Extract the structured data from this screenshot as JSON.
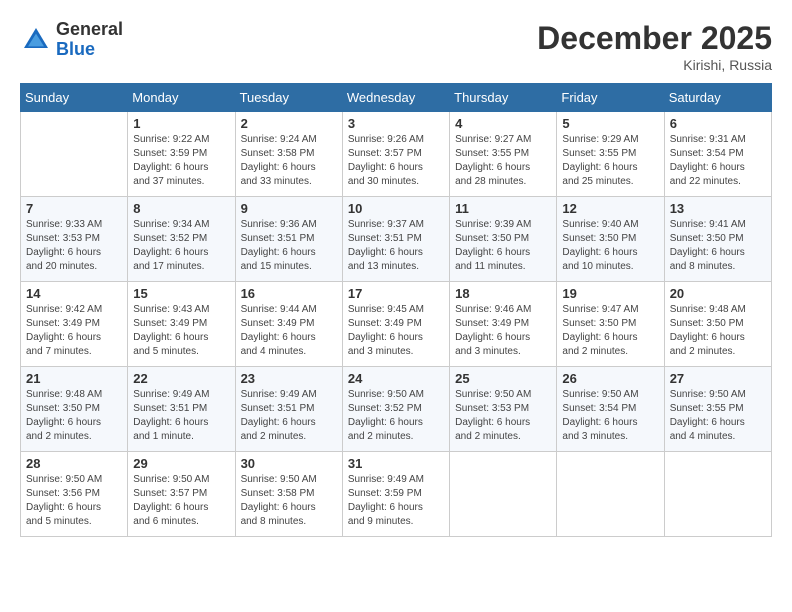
{
  "header": {
    "logo_general": "General",
    "logo_blue": "Blue",
    "month_title": "December 2025",
    "location": "Kirishi, Russia"
  },
  "days_of_week": [
    "Sunday",
    "Monday",
    "Tuesday",
    "Wednesday",
    "Thursday",
    "Friday",
    "Saturday"
  ],
  "weeks": [
    [
      {
        "day": "",
        "info": ""
      },
      {
        "day": "1",
        "info": "Sunrise: 9:22 AM\nSunset: 3:59 PM\nDaylight: 6 hours\nand 37 minutes."
      },
      {
        "day": "2",
        "info": "Sunrise: 9:24 AM\nSunset: 3:58 PM\nDaylight: 6 hours\nand 33 minutes."
      },
      {
        "day": "3",
        "info": "Sunrise: 9:26 AM\nSunset: 3:57 PM\nDaylight: 6 hours\nand 30 minutes."
      },
      {
        "day": "4",
        "info": "Sunrise: 9:27 AM\nSunset: 3:55 PM\nDaylight: 6 hours\nand 28 minutes."
      },
      {
        "day": "5",
        "info": "Sunrise: 9:29 AM\nSunset: 3:55 PM\nDaylight: 6 hours\nand 25 minutes."
      },
      {
        "day": "6",
        "info": "Sunrise: 9:31 AM\nSunset: 3:54 PM\nDaylight: 6 hours\nand 22 minutes."
      }
    ],
    [
      {
        "day": "7",
        "info": "Sunrise: 9:33 AM\nSunset: 3:53 PM\nDaylight: 6 hours\nand 20 minutes."
      },
      {
        "day": "8",
        "info": "Sunrise: 9:34 AM\nSunset: 3:52 PM\nDaylight: 6 hours\nand 17 minutes."
      },
      {
        "day": "9",
        "info": "Sunrise: 9:36 AM\nSunset: 3:51 PM\nDaylight: 6 hours\nand 15 minutes."
      },
      {
        "day": "10",
        "info": "Sunrise: 9:37 AM\nSunset: 3:51 PM\nDaylight: 6 hours\nand 13 minutes."
      },
      {
        "day": "11",
        "info": "Sunrise: 9:39 AM\nSunset: 3:50 PM\nDaylight: 6 hours\nand 11 minutes."
      },
      {
        "day": "12",
        "info": "Sunrise: 9:40 AM\nSunset: 3:50 PM\nDaylight: 6 hours\nand 10 minutes."
      },
      {
        "day": "13",
        "info": "Sunrise: 9:41 AM\nSunset: 3:50 PM\nDaylight: 6 hours\nand 8 minutes."
      }
    ],
    [
      {
        "day": "14",
        "info": "Sunrise: 9:42 AM\nSunset: 3:49 PM\nDaylight: 6 hours\nand 7 minutes."
      },
      {
        "day": "15",
        "info": "Sunrise: 9:43 AM\nSunset: 3:49 PM\nDaylight: 6 hours\nand 5 minutes."
      },
      {
        "day": "16",
        "info": "Sunrise: 9:44 AM\nSunset: 3:49 PM\nDaylight: 6 hours\nand 4 minutes."
      },
      {
        "day": "17",
        "info": "Sunrise: 9:45 AM\nSunset: 3:49 PM\nDaylight: 6 hours\nand 3 minutes."
      },
      {
        "day": "18",
        "info": "Sunrise: 9:46 AM\nSunset: 3:49 PM\nDaylight: 6 hours\nand 3 minutes."
      },
      {
        "day": "19",
        "info": "Sunrise: 9:47 AM\nSunset: 3:50 PM\nDaylight: 6 hours\nand 2 minutes."
      },
      {
        "day": "20",
        "info": "Sunrise: 9:48 AM\nSunset: 3:50 PM\nDaylight: 6 hours\nand 2 minutes."
      }
    ],
    [
      {
        "day": "21",
        "info": "Sunrise: 9:48 AM\nSunset: 3:50 PM\nDaylight: 6 hours\nand 2 minutes."
      },
      {
        "day": "22",
        "info": "Sunrise: 9:49 AM\nSunset: 3:51 PM\nDaylight: 6 hours\nand 1 minute."
      },
      {
        "day": "23",
        "info": "Sunrise: 9:49 AM\nSunset: 3:51 PM\nDaylight: 6 hours\nand 2 minutes."
      },
      {
        "day": "24",
        "info": "Sunrise: 9:50 AM\nSunset: 3:52 PM\nDaylight: 6 hours\nand 2 minutes."
      },
      {
        "day": "25",
        "info": "Sunrise: 9:50 AM\nSunset: 3:53 PM\nDaylight: 6 hours\nand 2 minutes."
      },
      {
        "day": "26",
        "info": "Sunrise: 9:50 AM\nSunset: 3:54 PM\nDaylight: 6 hours\nand 3 minutes."
      },
      {
        "day": "27",
        "info": "Sunrise: 9:50 AM\nSunset: 3:55 PM\nDaylight: 6 hours\nand 4 minutes."
      }
    ],
    [
      {
        "day": "28",
        "info": "Sunrise: 9:50 AM\nSunset: 3:56 PM\nDaylight: 6 hours\nand 5 minutes."
      },
      {
        "day": "29",
        "info": "Sunrise: 9:50 AM\nSunset: 3:57 PM\nDaylight: 6 hours\nand 6 minutes."
      },
      {
        "day": "30",
        "info": "Sunrise: 9:50 AM\nSunset: 3:58 PM\nDaylight: 6 hours\nand 8 minutes."
      },
      {
        "day": "31",
        "info": "Sunrise: 9:49 AM\nSunset: 3:59 PM\nDaylight: 6 hours\nand 9 minutes."
      },
      {
        "day": "",
        "info": ""
      },
      {
        "day": "",
        "info": ""
      },
      {
        "day": "",
        "info": ""
      }
    ]
  ]
}
